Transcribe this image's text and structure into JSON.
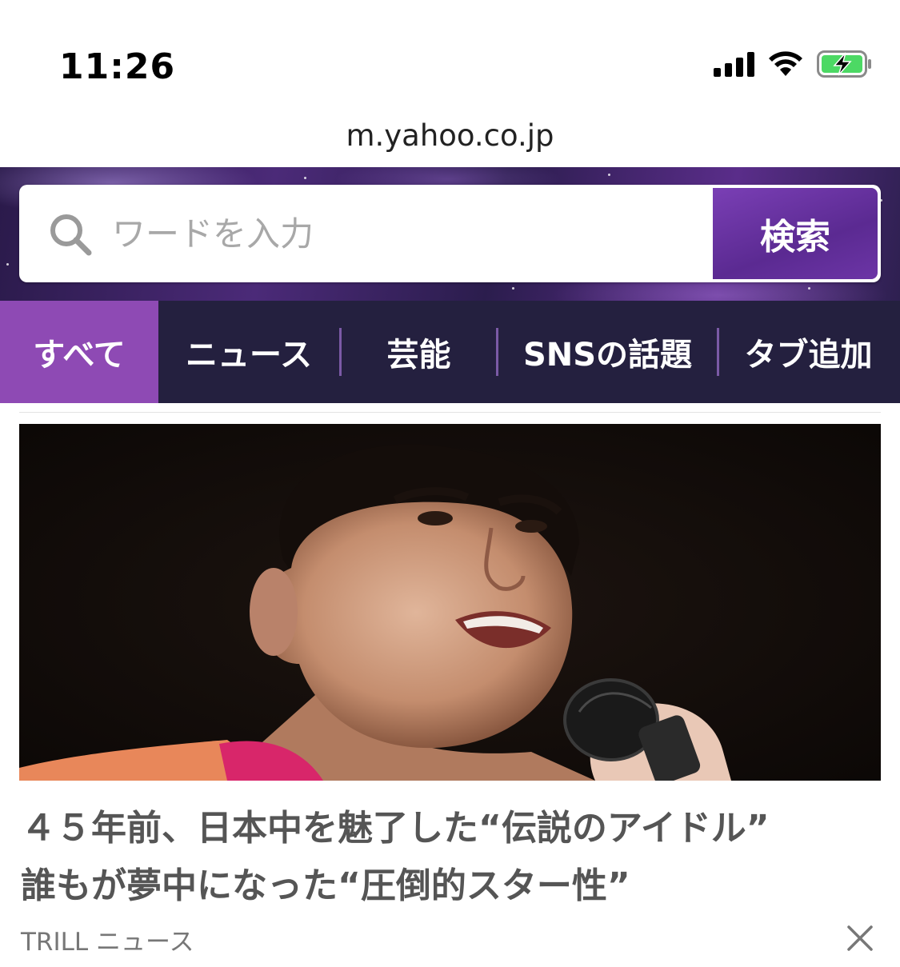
{
  "status_bar": {
    "time": "11:26",
    "icons": [
      "cellular-signal-icon",
      "wifi-icon",
      "battery-charging-icon"
    ],
    "battery_color": "#4cd964"
  },
  "browser": {
    "url": "m.yahoo.co.jp"
  },
  "search": {
    "placeholder": "ワードを入力",
    "button_label": "検索",
    "icon": "search-icon"
  },
  "tabs": [
    {
      "label": "すべて",
      "active": true
    },
    {
      "label": "ニュース",
      "active": false
    },
    {
      "label": "芸能",
      "active": false
    },
    {
      "label": "SNSの話題",
      "active": false
    },
    {
      "label": "タブ追加",
      "active": false
    }
  ],
  "article": {
    "headline_line1": "４５年前、日本中を魅了した“伝説のアイドル”",
    "headline_line2": "誰もが夢中になった“圧倒的スター性”",
    "source": "TRILL ニュース",
    "dismiss_icon": "close-icon"
  },
  "colors": {
    "accent_purple": "#8e4ab4",
    "tab_bar_bg": "#24203f",
    "search_button": "#6c35a6"
  }
}
